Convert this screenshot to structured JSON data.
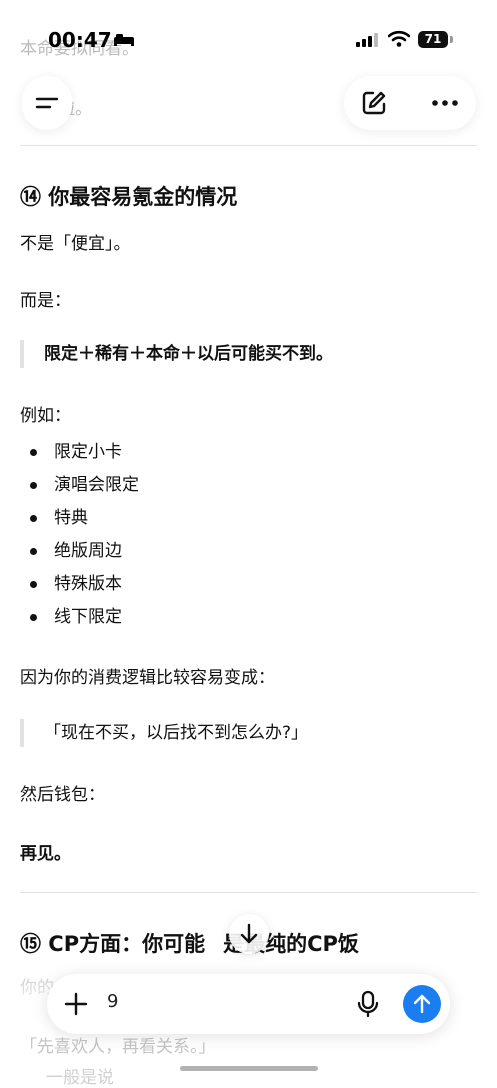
{
  "ghost": {
    "top_behind_status": "本命要拟同看。",
    "top_behind_nav": "啦。",
    "bottom_1": "你的",
    "bottom_2": "「先喜欢人，再看关系。」",
    "bottom_3": "一般是说"
  },
  "status_bar": {
    "time": "00:47",
    "battery": "71"
  },
  "section14": {
    "heading": "⑭ 你最容易氪金的情况",
    "line1": "不是「便宜」。",
    "line2": "而是：",
    "quote1": "限定＋稀有＋本命＋以后可能买不到。",
    "line3": "例如：",
    "bullets": [
      "限定小卡",
      "演唱会限定",
      "特典",
      "绝版周边",
      "特殊版本",
      "线下限定"
    ],
    "line4": "因为你的消费逻辑比较容易变成：",
    "quote2": "「现在不买，以后找不到怎么办?」",
    "line5": "然后钱包：",
    "line6": "再见。"
  },
  "section15": {
    "heading": "⑮ CP方面：你可能",
    "heading_tail": "是最纯的CP饭"
  },
  "composer": {
    "value": "9"
  },
  "icons": {
    "menu": "menu-icon",
    "edit": "edit-icon",
    "more": "more-icon",
    "scroll": "arrow-down-icon",
    "add": "plus-icon",
    "mic": "microphone-icon",
    "send": "arrow-up-icon"
  },
  "colors": {
    "accent": "#1a7ef0"
  }
}
